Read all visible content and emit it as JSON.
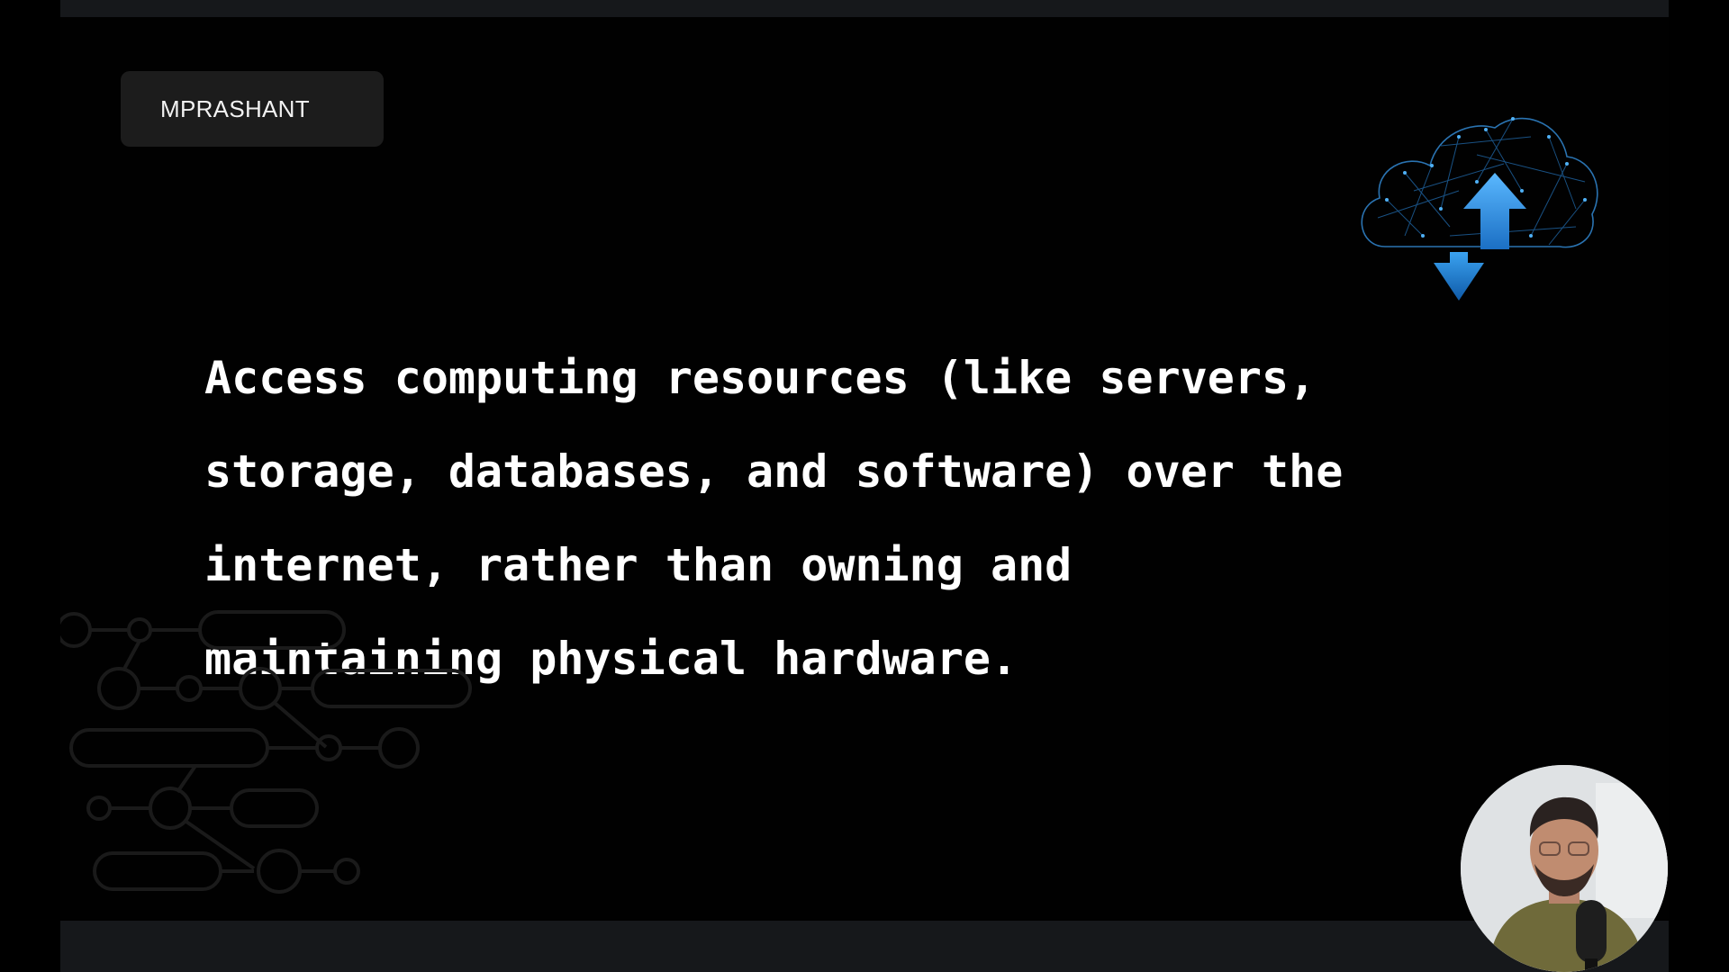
{
  "brand": {
    "label": "MPRASHANT"
  },
  "slide": {
    "body_text": "Access computing resources (like servers,\nstorage, databases, and software) over the\ninternet, rather than owning and\nmaintaining physical hardware."
  },
  "icons": {
    "cloud": "cloud-upload-download-icon",
    "circuit": "circuit-decoration",
    "presenter": "presenter-webcam"
  },
  "colors": {
    "background": "#010101",
    "strip": "#16181b",
    "badge": "#1c1c1c",
    "text": "#ffffff",
    "cloud_accent": "#2f9be8"
  }
}
